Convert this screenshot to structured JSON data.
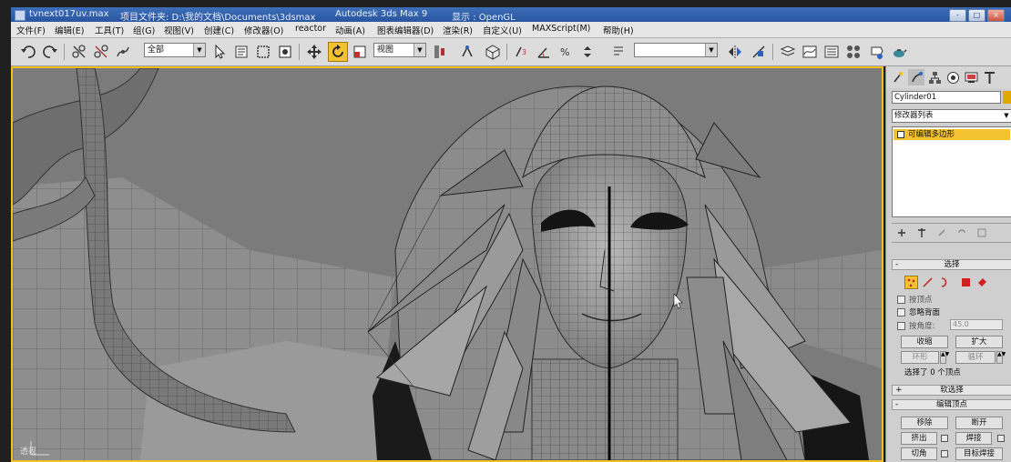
{
  "title_bar": {
    "file_name": "tvnext017uv.max",
    "project_folder": "项目文件夹: D:\\我的文档\\Documents\\3dsmax",
    "app_name": "Autodesk 3ds Max 9",
    "display_mode": "显示 : OpenGL",
    "buttons": [
      "-",
      "□",
      "×"
    ]
  },
  "menu": {
    "items": [
      "文件(F)",
      "编辑(E)",
      "工具(T)",
      "组(G)",
      "视图(V)",
      "创建(C)",
      "修改器(O)",
      "reactor",
      "动画(A)",
      "图表编辑器(D)",
      "渲染(R)",
      "自定义(U)",
      "MAXScript(M)",
      "帮助(H)"
    ]
  },
  "toolbar": {
    "selection_filter": "全部",
    "reference_coord": "视图",
    "named_selection": ""
  },
  "viewport": {
    "label": "透视"
  },
  "command_panel": {
    "object_name": "Cylinder01",
    "object_color": "#e0a800",
    "modifier_list": "修改器列表",
    "stack_item": "可编辑多边形",
    "selection_rollout": "选择",
    "checkbox_by_vertex": "按顶点",
    "checkbox_ignore_backfacing": "忽略背面",
    "checkbox_by_angle": "按角度:",
    "angle_value": "45.0",
    "shrink_label": "收缩",
    "grow_label": "扩大",
    "ring_label": "环形",
    "loop_label": "循环",
    "selection_status": "选择了 0 个顶点",
    "soft_selection_rollout": "软选择",
    "edit_vertices_rollout": "编辑顶点",
    "remove_label": "移除",
    "break_label": "断开",
    "extrude_label": "挤出",
    "weld_label": "焊接",
    "chamfer_label": "切角",
    "target_weld_label": "目标焊接"
  }
}
